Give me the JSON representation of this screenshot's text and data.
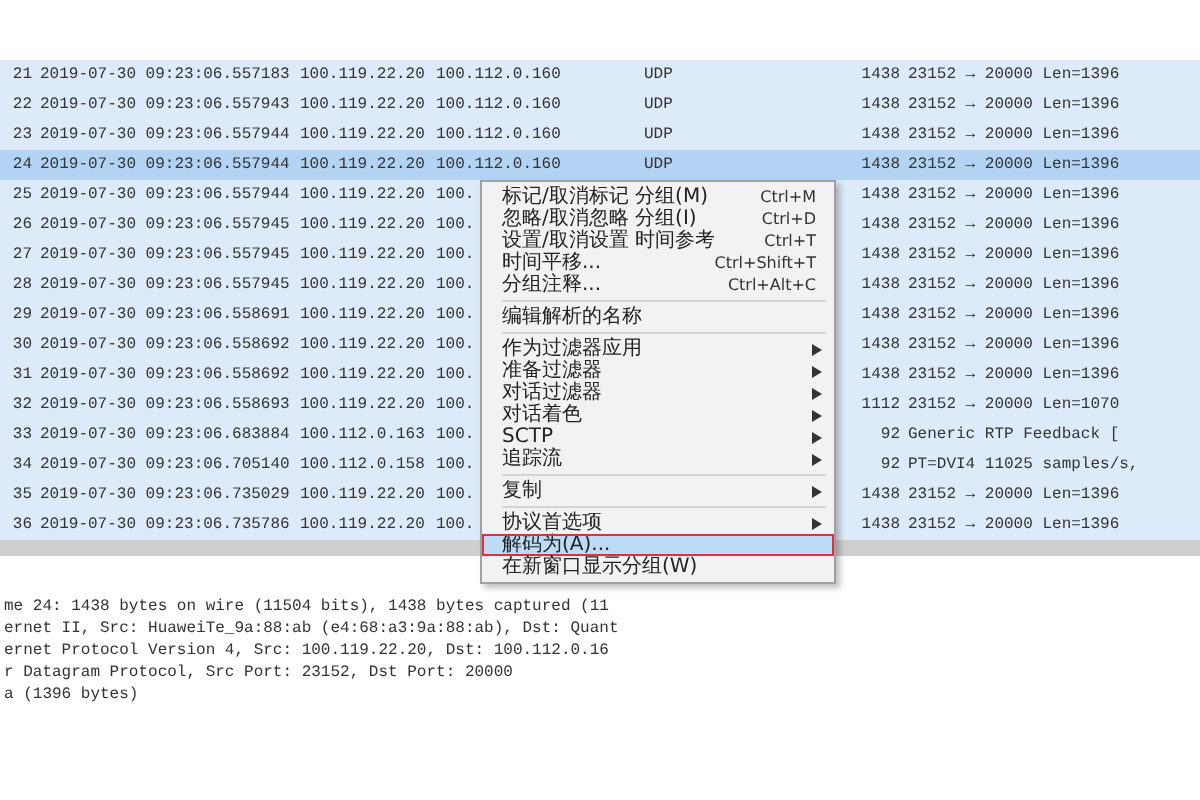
{
  "packet_list": {
    "rows": [
      {
        "no": "21",
        "time": "2019-07-30 09:23:06.557183",
        "source": "100.119.22.20",
        "destination": "100.112.0.160",
        "protocol": "UDP",
        "length": "1438",
        "info": "23152 → 20000 Len=1396",
        "selected": false
      },
      {
        "no": "22",
        "time": "2019-07-30 09:23:06.557943",
        "source": "100.119.22.20",
        "destination": "100.112.0.160",
        "protocol": "UDP",
        "length": "1438",
        "info": "23152 → 20000 Len=1396",
        "selected": false
      },
      {
        "no": "23",
        "time": "2019-07-30 09:23:06.557944",
        "source": "100.119.22.20",
        "destination": "100.112.0.160",
        "protocol": "UDP",
        "length": "1438",
        "info": "23152 → 20000 Len=1396",
        "selected": false
      },
      {
        "no": "24",
        "time": "2019-07-30 09:23:06.557944",
        "source": "100.119.22.20",
        "destination": "100.112.0.160",
        "protocol": "UDP",
        "length": "1438",
        "info": "23152 → 20000 Len=1396",
        "selected": true
      },
      {
        "no": "25",
        "time": "2019-07-30 09:23:06.557944",
        "source": "100.119.22.20",
        "destination": "100.",
        "length": "1438",
        "info": "23152 → 20000 Len=1396",
        "selected": false
      },
      {
        "no": "26",
        "time": "2019-07-30 09:23:06.557945",
        "source": "100.119.22.20",
        "destination": "100.",
        "length": "1438",
        "info": "23152 → 20000 Len=1396",
        "selected": false
      },
      {
        "no": "27",
        "time": "2019-07-30 09:23:06.557945",
        "source": "100.119.22.20",
        "destination": "100.",
        "length": "1438",
        "info": "23152 → 20000 Len=1396",
        "selected": false
      },
      {
        "no": "28",
        "time": "2019-07-30 09:23:06.557945",
        "source": "100.119.22.20",
        "destination": "100.",
        "length": "1438",
        "info": "23152 → 20000 Len=1396",
        "selected": false
      },
      {
        "no": "29",
        "time": "2019-07-30 09:23:06.558691",
        "source": "100.119.22.20",
        "destination": "100.",
        "length": "1438",
        "info": "23152 → 20000 Len=1396",
        "selected": false
      },
      {
        "no": "30",
        "time": "2019-07-30 09:23:06.558692",
        "source": "100.119.22.20",
        "destination": "100.",
        "length": "1438",
        "info": "23152 → 20000 Len=1396",
        "selected": false
      },
      {
        "no": "31",
        "time": "2019-07-30 09:23:06.558692",
        "source": "100.119.22.20",
        "destination": "100.",
        "length": "1438",
        "info": "23152 → 20000 Len=1396",
        "selected": false
      },
      {
        "no": "32",
        "time": "2019-07-30 09:23:06.558693",
        "source": "100.119.22.20",
        "destination": "100.",
        "length": "1112",
        "info": "23152 → 20000 Len=1070",
        "selected": false
      },
      {
        "no": "33",
        "time": "2019-07-30 09:23:06.683884",
        "source": "100.112.0.163",
        "destination": "100.",
        "length": "92",
        "info": "Generic RTP Feedback  [",
        "selected": false
      },
      {
        "no": "34",
        "time": "2019-07-30 09:23:06.705140",
        "source": "100.112.0.158",
        "destination": "100.",
        "length": "92",
        "info": "PT=DVI4 11025 samples/s,",
        "selected": false
      },
      {
        "no": "35",
        "time": "2019-07-30 09:23:06.735029",
        "source": "100.119.22.20",
        "destination": "100.",
        "length": "1438",
        "info": "23152 → 20000 Len=1396",
        "selected": false
      },
      {
        "no": "36",
        "time": "2019-07-30 09:23:06.735786",
        "source": "100.119.22.20",
        "destination": "100.",
        "length": "1438",
        "info": "23152 → 20000 Len=1396",
        "selected": false
      }
    ]
  },
  "packet_details": [
    "me 24: 1438 bytes on wire (11504 bits), 1438 bytes captured (11",
    "ernet II, Src: HuaweiTe_9a:88:ab (e4:68:a3:9a:88:ab), Dst: Quant",
    "ernet Protocol Version 4, Src: 100.119.22.20, Dst: 100.112.0.16",
    "r Datagram Protocol, Src Port: 23152, Dst Port: 20000",
    "a (1396 bytes)"
  ],
  "context_menu": {
    "items": [
      {
        "kind": "item",
        "label": "标记/取消标记 分组(M)",
        "shortcut": "Ctrl+M",
        "submenu": false,
        "selected": false,
        "outlined": false
      },
      {
        "kind": "item",
        "label": "忽略/取消忽略 分组(I)",
        "shortcut": "Ctrl+D",
        "submenu": false,
        "selected": false,
        "outlined": false
      },
      {
        "kind": "item",
        "label": "设置/取消设置 时间参考",
        "shortcut": "Ctrl+T",
        "submenu": false,
        "selected": false,
        "outlined": false
      },
      {
        "kind": "item",
        "label": "时间平移...",
        "shortcut": "Ctrl+Shift+T",
        "submenu": false,
        "selected": false,
        "outlined": false
      },
      {
        "kind": "item",
        "label": "分组注释...",
        "shortcut": "Ctrl+Alt+C",
        "submenu": false,
        "selected": false,
        "outlined": false
      },
      {
        "kind": "separator"
      },
      {
        "kind": "item",
        "label": "编辑解析的名称",
        "submenu": false,
        "selected": false,
        "outlined": false
      },
      {
        "kind": "separator"
      },
      {
        "kind": "item",
        "label": "作为过滤器应用",
        "submenu": true,
        "selected": false,
        "outlined": false
      },
      {
        "kind": "item",
        "label": "准备过滤器",
        "submenu": true,
        "selected": false,
        "outlined": false
      },
      {
        "kind": "item",
        "label": "对话过滤器",
        "submenu": true,
        "selected": false,
        "outlined": false
      },
      {
        "kind": "item",
        "label": "对话着色",
        "submenu": true,
        "selected": false,
        "outlined": false
      },
      {
        "kind": "item",
        "label": "SCTP",
        "submenu": true,
        "selected": false,
        "outlined": false
      },
      {
        "kind": "item",
        "label": "追踪流",
        "submenu": true,
        "selected": false,
        "outlined": false
      },
      {
        "kind": "separator"
      },
      {
        "kind": "item",
        "label": "复制",
        "submenu": true,
        "selected": false,
        "outlined": false
      },
      {
        "kind": "separator"
      },
      {
        "kind": "item",
        "label": "协议首选项",
        "submenu": true,
        "selected": false,
        "outlined": false
      },
      {
        "kind": "item",
        "label": "解码为(A)...",
        "submenu": false,
        "selected": true,
        "outlined": true
      },
      {
        "kind": "item",
        "label": "在新窗口显示分组(W)",
        "submenu": false,
        "selected": false,
        "outlined": false
      }
    ]
  }
}
